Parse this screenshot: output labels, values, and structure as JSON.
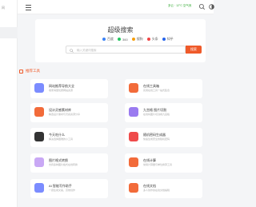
{
  "sidebar": {
    "logo_text": "网"
  },
  "topbar": {
    "weather_text": "多云 · 12°C 空气良"
  },
  "search": {
    "title": "超级搜索",
    "engines": [
      {
        "label": "百度",
        "color": "#3b82f6"
      },
      {
        "label": "360",
        "color": "#22c55e"
      },
      {
        "label": "搜狗",
        "color": "#f59e0b"
      },
      {
        "label": "头条",
        "color": "#ef4444"
      },
      {
        "label": "知乎",
        "color": "#2563eb"
      }
    ],
    "placeholder": "输入关键词搜索",
    "button_label": "搜索"
  },
  "section": {
    "title": "推荐工具"
  },
  "cards": [
    {
      "title": "网站推荐导航大全",
      "desc": "收录海量优质网站资源",
      "color": "#7b8cff"
    },
    {
      "title": "在线工具箱",
      "desc": "实用在线工具一站式集合",
      "color": "#f26b3a"
    },
    {
      "title": "设计灵感素材库",
      "desc": "精选设计素材与灵感资源分享",
      "color": "#f26b3a"
    },
    {
      "title": "九宫格 图片切割",
      "desc": "在线将图片切割成九宫格",
      "color": "#9a7bf0"
    },
    {
      "title": "今天吃什么",
      "desc": "解决选择困难的小工具",
      "color": "#333333"
    },
    {
      "title": "随机密码生成器",
      "desc": "快速生成安全的随机密码",
      "color": "#ef4b4b"
    },
    {
      "title": "图片格式转换",
      "desc": "支持多种图片格式在线转换",
      "color": "#c9a8f5"
    },
    {
      "title": "在线计算",
      "desc": "常用计算器与单位换算工具",
      "color": "#f26b3a"
    },
    {
      "title": "AI 智能写作助手",
      "desc": "一键生成文案，高效创作",
      "color": "#7b8cff"
    },
    {
      "title": "在线文档",
      "desc": "多人协作的在线文档编辑",
      "color": "#f26b3a"
    }
  ]
}
